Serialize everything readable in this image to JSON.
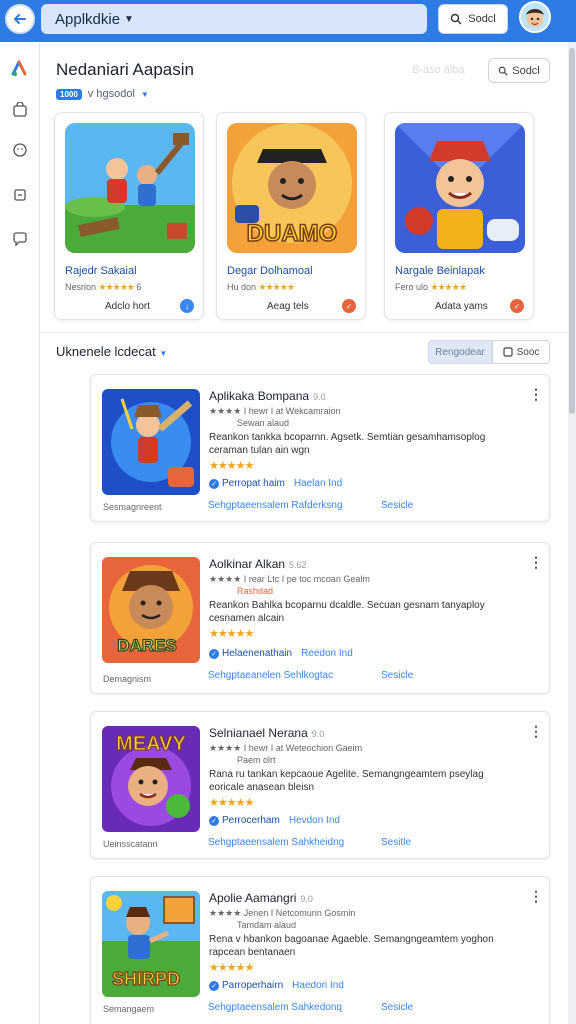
{
  "topbar": {
    "app_name": "Applkdkie",
    "search_label": "Sodcl",
    "icons": [
      "back-arrow-icon",
      "search-icon",
      "avatar"
    ]
  },
  "sidebar": {
    "icons": [
      "logo-icon",
      "bag-icon",
      "face-icon",
      "box-icon",
      "chat-icon"
    ]
  },
  "header": {
    "title": "Nedaniari Aapasin",
    "faded_link": "B-aso alba",
    "search_label": "Sodcl"
  },
  "filter": {
    "chip": "1000",
    "label": "v hgsodol"
  },
  "featured": [
    {
      "title": "Rajedr Sakaial",
      "meta": "Nesrion",
      "stars": "★★★★★",
      "rating_suffix": "6",
      "action": "Adclo hort",
      "badge_color": "#3b86f0"
    },
    {
      "title": "Degar Dolhamoal",
      "meta": "Hu don",
      "stars": "★★★★★",
      "rating_suffix": "",
      "action": "Aeag tels",
      "badge_color": "#e8643a"
    },
    {
      "title": "Nargale Beinlapak",
      "meta": "Fero ulo",
      "stars": "★★★★★",
      "rating_suffix": "",
      "action": "Adata yams",
      "badge_color": "#e8643a"
    }
  ],
  "section": {
    "title": "Uknenele lcdecat",
    "tab_label": "Rengodear",
    "search_label": "Sooc"
  },
  "apps": [
    {
      "title": "Aplikaka Bompana",
      "version": "9.0",
      "sub1": "★★★★ I hewr I at Wekcamraion",
      "sub2": "Sewan alaud",
      "desc": "Reankon tankka bcoparnn. Agsetk. Semtian gesamhamsoplog ceraman tulan ain wgn",
      "rating": "★★★★★",
      "developer": "Perropat haim",
      "dev_link": "Haelan Ind",
      "category": "Sesmagnreent",
      "tags": "Sehgptaeensalem Rafderksng",
      "spec": "Sesicle"
    },
    {
      "title": "Aolkinar Alkan",
      "version": "5.62",
      "sub1": "★★★★ I rear Ltc I pe toc mcoan Gealm",
      "sub2": "Rashdad",
      "desc": "Reankon Bahlka bcoparnu dcaldle. Secuan gesnam tanyaploy cesnamen alcain",
      "rating": "★★★★★",
      "developer": "Helaenenathain",
      "dev_link": "Reedon Ind",
      "category": "Demagnism",
      "tags": "Sehgptaeanelen Sehlkogtac",
      "spec": "Sesicle"
    },
    {
      "title": "Selnianael Nerana",
      "version": "9.0",
      "sub1": "★★★★ I hewr I at Weteochion Gaeim",
      "sub2": "Paem olrt",
      "desc": "Rana ru tankan kepcaoue Agelite. Semangngeamtem pseylag eoricale anasean bleisn",
      "rating": "★★★★★",
      "developer": "Perrocerham",
      "dev_link": "Hevdon Ind",
      "category": "Ueinsscatann",
      "tags": "Sehgptaeensalem Sahkheidng",
      "spec": "Sesitle"
    },
    {
      "title": "Apolie Aamangri",
      "version": "9.0",
      "sub1": "★★★★ Jenen I Netcomunn Gosmin",
      "sub2": "Tamdam alaud",
      "desc": "Rena v hbankon bagoanae Agaeble. Semangngeamtem yoghon rapcean bentanaen",
      "rating": "★★★★★",
      "developer": "Parroperhairn",
      "dev_link": "Haedon Ind",
      "category": "Semangaem",
      "tags": "Sehgptaeensalem Sahkedonq",
      "spec": "Sesicle"
    }
  ],
  "colors": {
    "accent": "#2f7be6",
    "star": "#f1a31a",
    "link": "#3b86f0"
  }
}
